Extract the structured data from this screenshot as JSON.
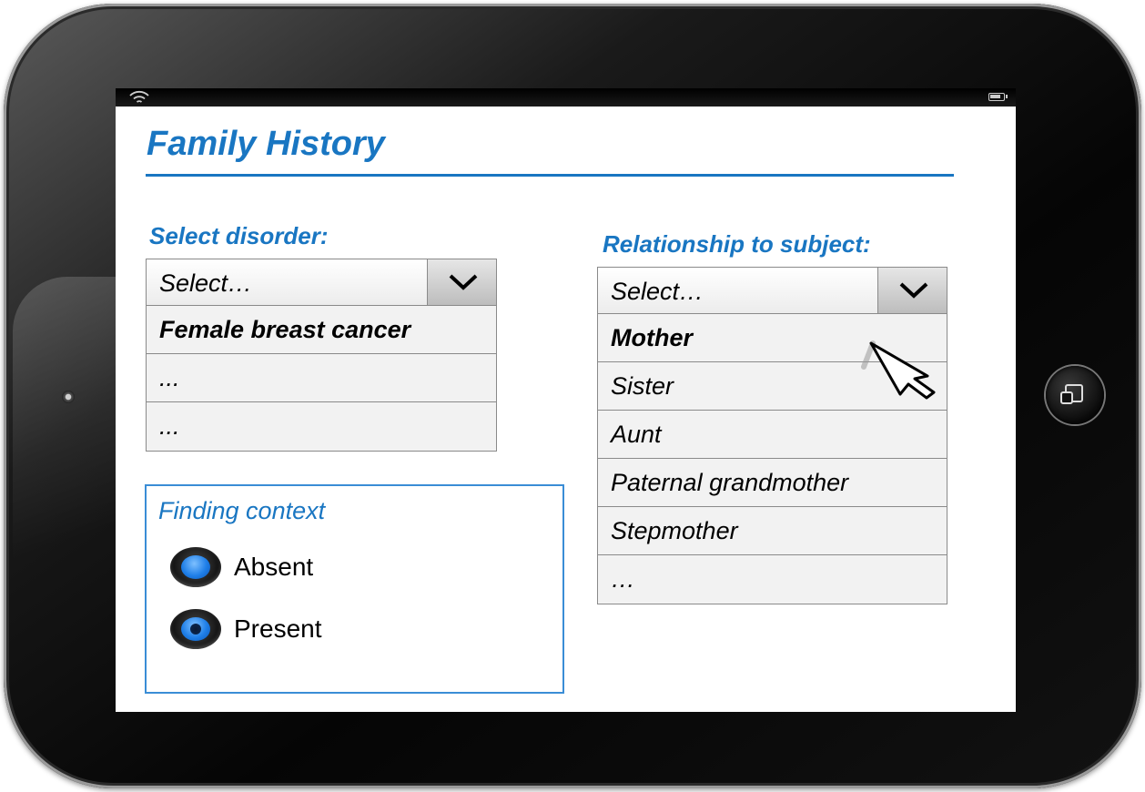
{
  "page": {
    "title": "Family History"
  },
  "disorder": {
    "label": "Select disorder:",
    "select_value": "Select…",
    "options": [
      "Female breast cancer",
      "...",
      "..."
    ],
    "selected_option": "Female breast cancer"
  },
  "relationship": {
    "label": "Relationship to subject:",
    "select_value": "Select…",
    "options": [
      "Mother",
      "Sister",
      "Aunt",
      "Paternal grandmother",
      "Stepmother",
      "…"
    ],
    "selected_option": "Mother"
  },
  "finding_context": {
    "title": "Finding context",
    "options": [
      {
        "label": "Absent",
        "checked": false
      },
      {
        "label": "Present",
        "checked": true
      }
    ]
  },
  "icons": {
    "status_left": "wifi-icon",
    "status_right": "battery-icon",
    "dropdown": "chevron-down-icon",
    "pointer": "hand-cursor-icon"
  },
  "colors": {
    "accent": "#1976c2",
    "radio": "#1f7fe8"
  }
}
